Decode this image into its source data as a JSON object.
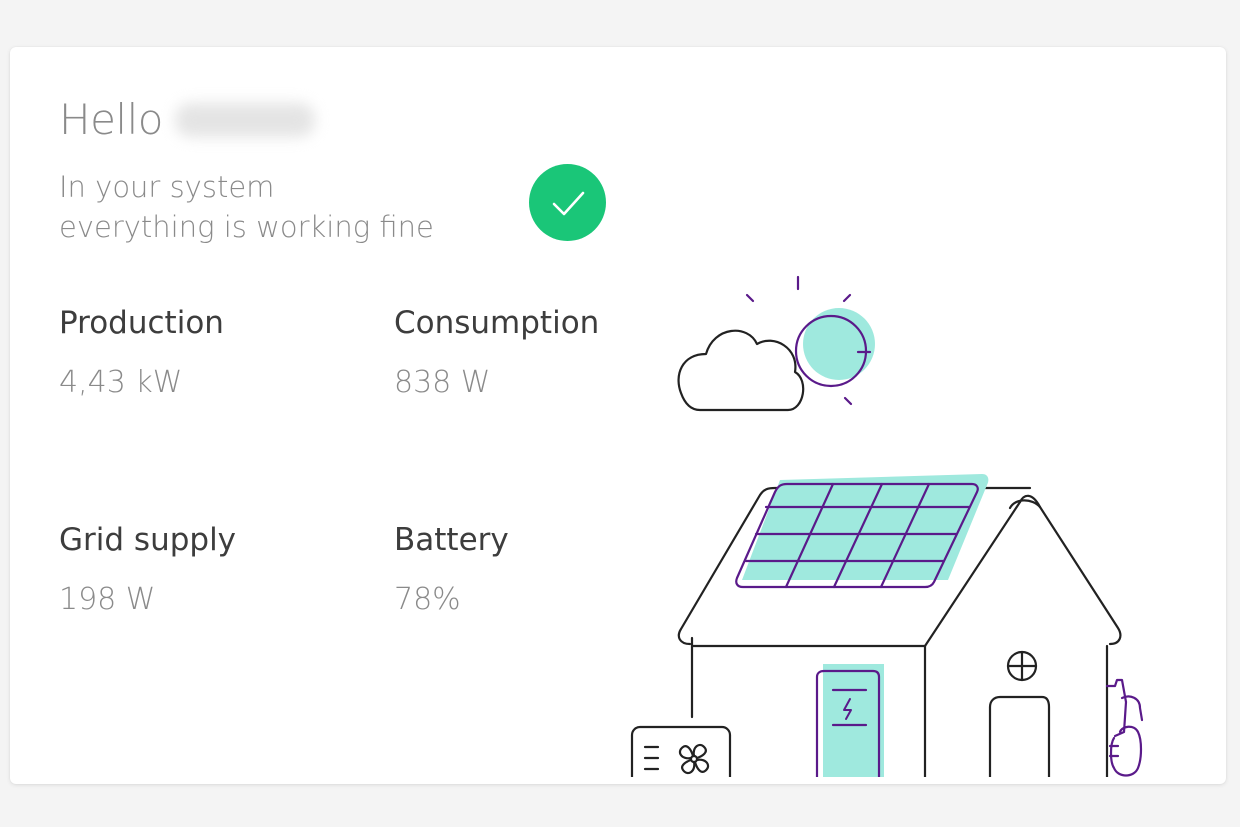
{
  "header": {
    "greeting": "Hello"
  },
  "status": {
    "line1": "In your system",
    "line2": "everything is working fine",
    "icon": "checkmark-icon",
    "color": "#1ac678"
  },
  "metrics": {
    "production": {
      "label": "Production",
      "value": "4,43 kW"
    },
    "consumption": {
      "label": "Consumption",
      "value": "838 W"
    },
    "grid_supply": {
      "label": "Grid supply",
      "value": "198 W"
    },
    "battery": {
      "label": "Battery",
      "value": "78%"
    }
  },
  "illustration": {
    "accent_teal": "#9fe9de",
    "accent_purple": "#5a1a8a",
    "line_color": "#222222"
  }
}
